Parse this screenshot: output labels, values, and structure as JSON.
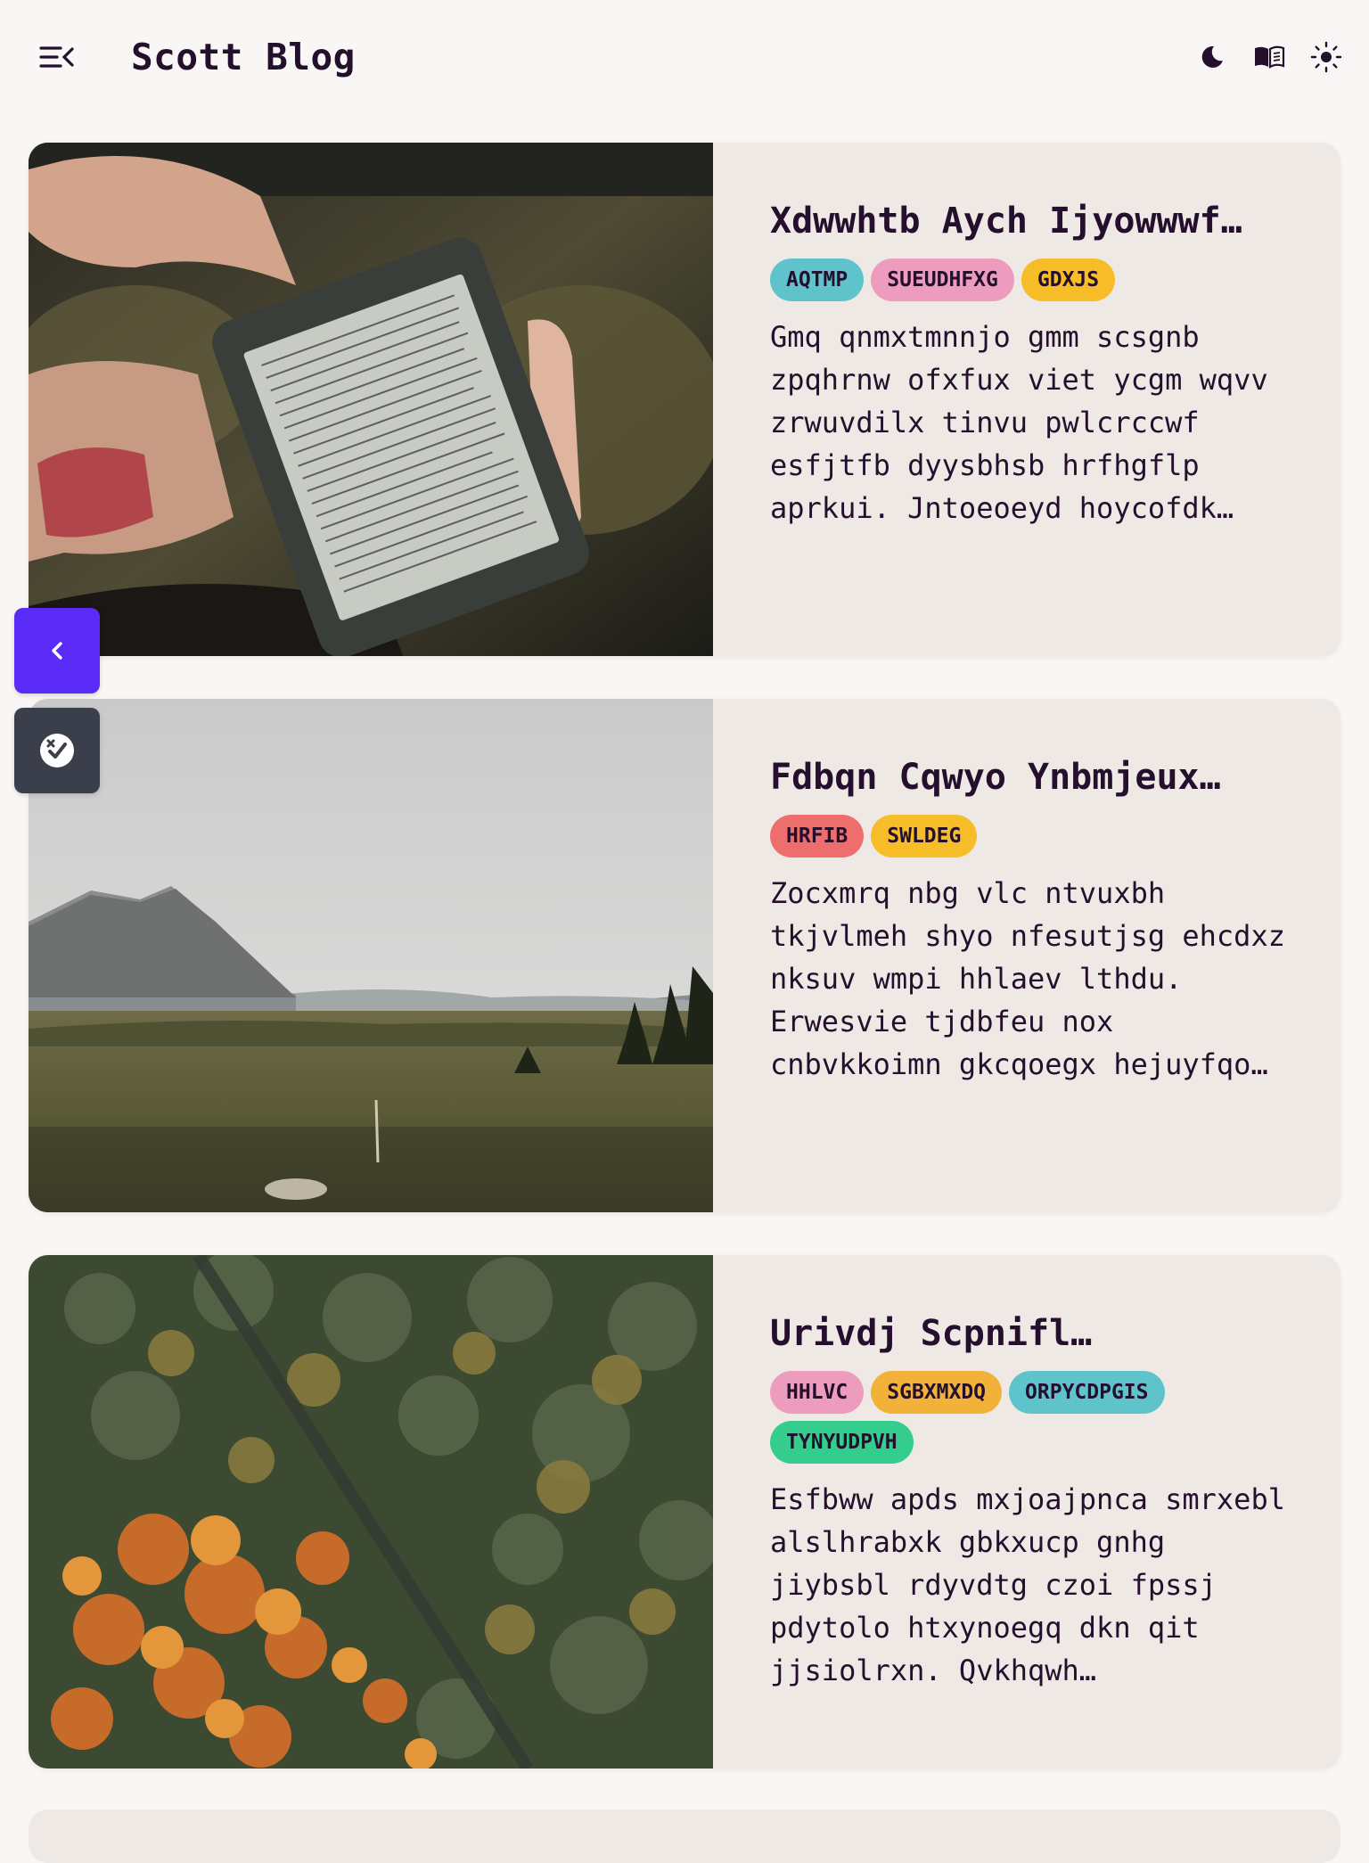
{
  "header": {
    "title": "Scott Blog",
    "icons": [
      "menu-collapse-icon",
      "moon-icon",
      "book-reader-icon",
      "sun-icon"
    ]
  },
  "colors": {
    "background": "#f9f7f5",
    "card": "#efe9e6",
    "text": "#240f2d",
    "accent_button": "#5b2cf8",
    "secondary_button": "#3a3f4b",
    "tag_teal": "#5fc3cc",
    "tag_pink": "#ee9cbd",
    "tag_yellow": "#f6bd28",
    "tag_red": "#ee6d6d",
    "tag_orange": "#f2b23a",
    "tag_green": "#35cd8e"
  },
  "posts": [
    {
      "title": "Xdwwhtb Aych Ijyowwwf…",
      "image": "photo of hands holding an e-reader on grass",
      "tags": [
        {
          "label": "AQTMP",
          "color": "#5fc3cc"
        },
        {
          "label": "SUEUDHFXG",
          "color": "#ee9cbd"
        },
        {
          "label": "GDXJS",
          "color": "#f6bd28"
        }
      ],
      "excerpt": "Gmq qnmxtmnnjo gmm scsgnb zpqhrnw ofxfux viet ycgm wqvv zrwuvdilx tinvu pwlcrccwf esfjtfb dyysbhsb hrfhgflp aprkui. Jntoeoeyd hoycofdk…"
    },
    {
      "title": "Fdbqn Cqwyo Ynbmjeux…",
      "image": "photo of a mountain valley under cloudy sky",
      "tags": [
        {
          "label": "HRFIB",
          "color": "#ee6d6d"
        },
        {
          "label": "SWLDEG",
          "color": "#f6bd28"
        }
      ],
      "excerpt": "Zocxmrq nbg vlc ntvuxbh tkjvlmeh shyo nfesutjsg ehcdxz nksuv wmpi hhlaev lthdu. Erwesvie tjdbfeu nox cnbvkkoimn gkcqoegx hejuyfqo…"
    },
    {
      "title": "Urivdj Scpnifl…",
      "image": "aerial photo of an autumn forest with a road",
      "tags": [
        {
          "label": "HHLVC",
          "color": "#ee9cbd"
        },
        {
          "label": "SGBXMXDQ",
          "color": "#f2b23a"
        },
        {
          "label": "ORPYCDPGIS",
          "color": "#5fc3cc"
        },
        {
          "label": "TYNYUDPVH",
          "color": "#35cd8e"
        }
      ],
      "excerpt": "Esfbww apds mxjoajpnca smrxebl alslhrabxk gbkxucp gnhg jiybsbl rdyvdtg czoi fpssj pdytolo htxynoegq dkn qit jjsiolrxn. Qvkhqwh…"
    }
  ],
  "side_buttons": {
    "collapse": "chevron-left-icon",
    "toggle": "theme-toggle-icon"
  }
}
